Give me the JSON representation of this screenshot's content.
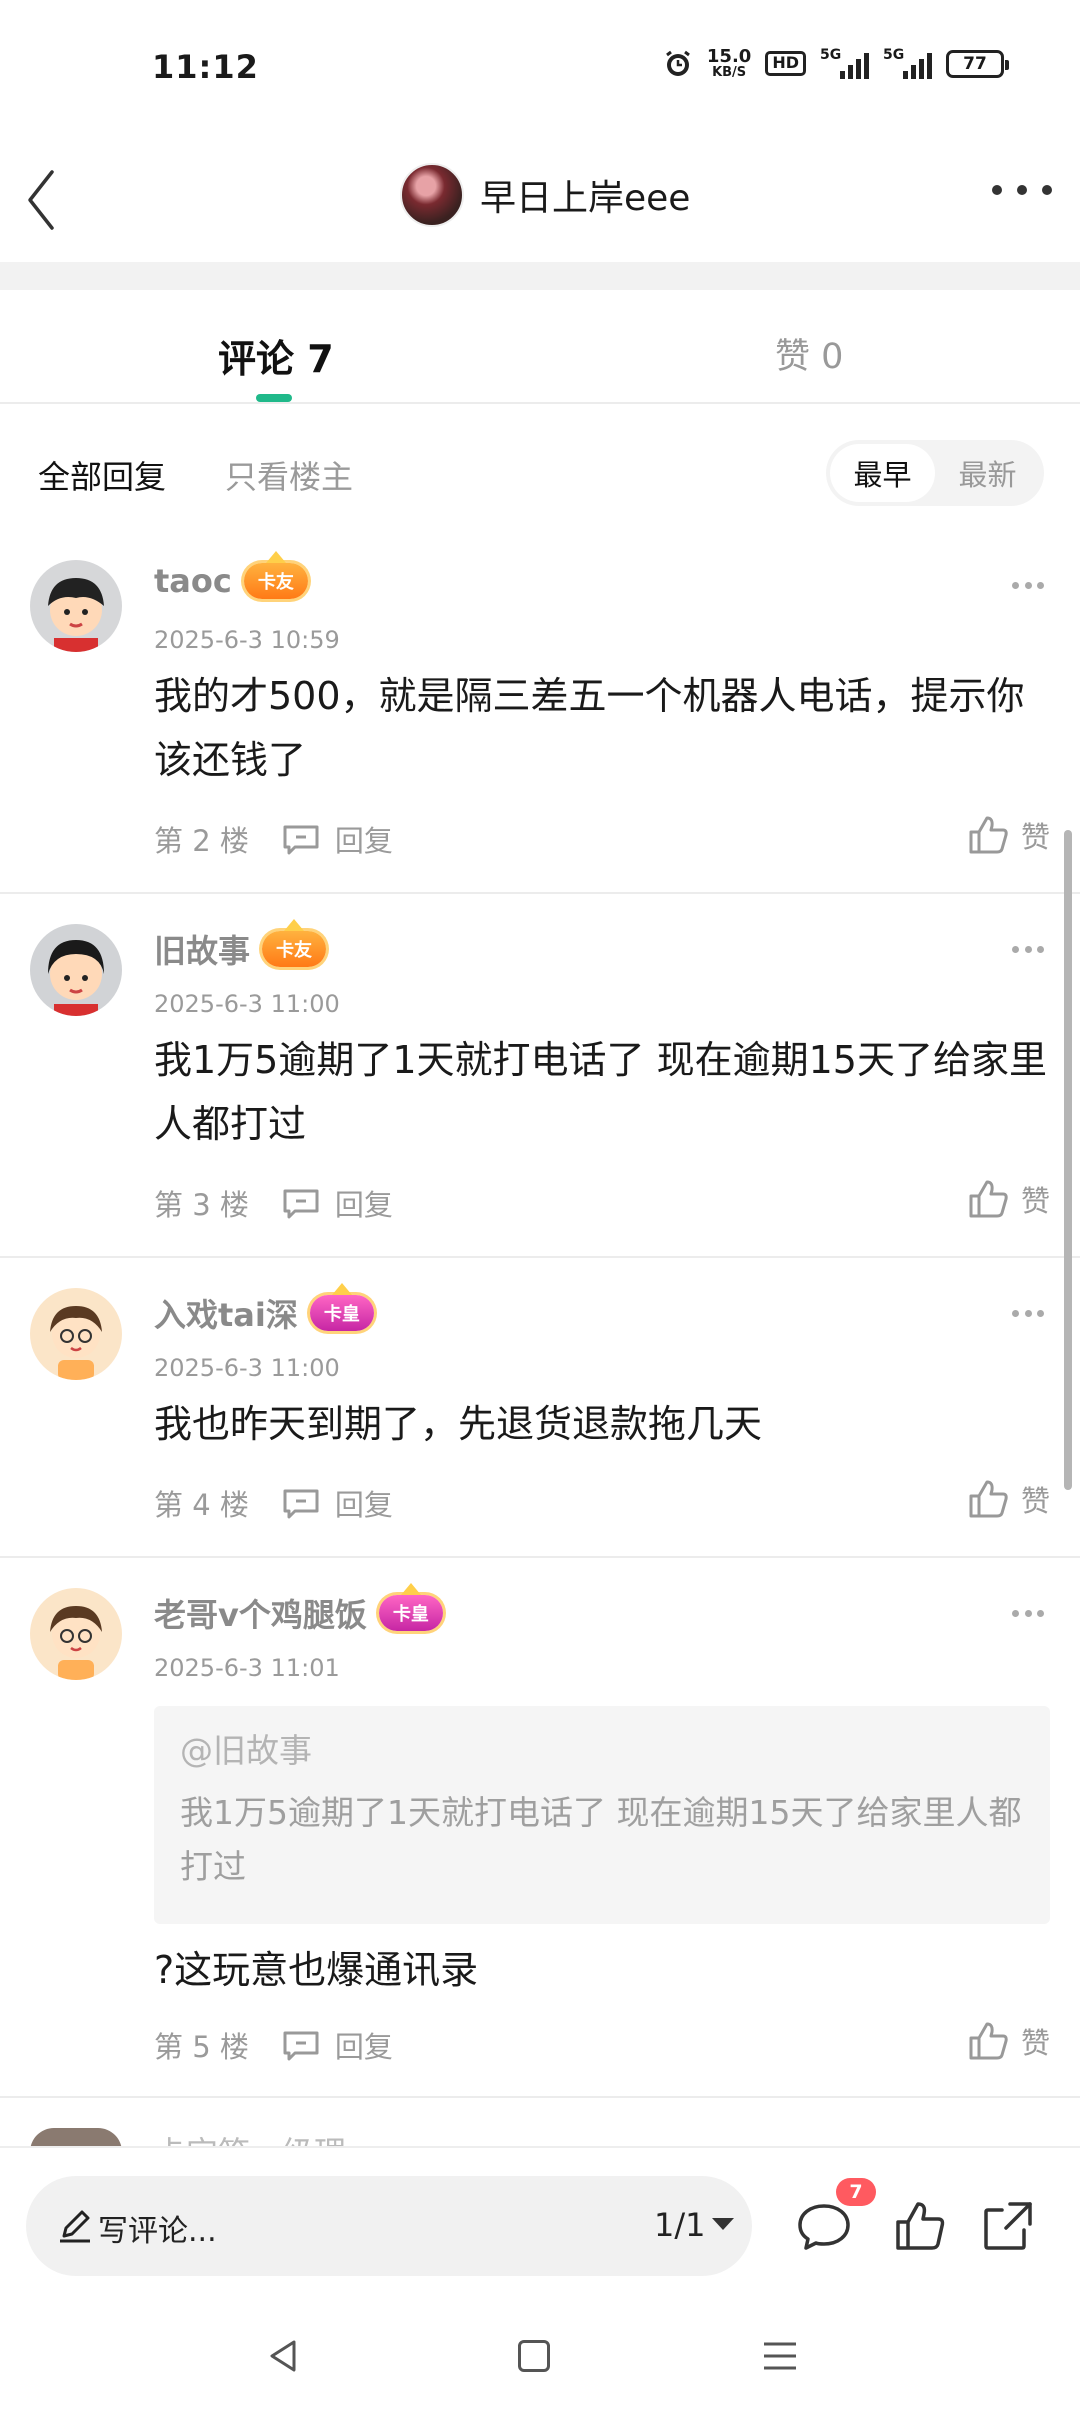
{
  "status_bar": {
    "time": "11:12",
    "net_speed_value": "15.0",
    "net_speed_unit": "KB/S",
    "hd_label": "HD",
    "signal1_label": "5G",
    "signal2_label": "5G",
    "battery": "77"
  },
  "header": {
    "title": "早日上岸eee"
  },
  "tabs": {
    "comments": "评论 7",
    "likes": "赞 0"
  },
  "filter": {
    "all_replies": "全部回复",
    "op_only": "只看楼主",
    "sort_earliest": "最早",
    "sort_latest": "最新"
  },
  "comments": [
    {
      "username": "taoc",
      "badge": "卡友",
      "time": "2025-6-3 10:59",
      "text": "我的才500，就是隔三差五一个机器人电话，提示你该还钱了",
      "floor": "第 2 楼",
      "reply": "回复",
      "like": "赞"
    },
    {
      "username": "旧故事",
      "badge": "卡友",
      "time": "2025-6-3 11:00",
      "text": "我1万5逾期了1天就打电话了 现在逾期15天了给家里人都打过",
      "floor": "第 3 楼",
      "reply": "回复",
      "like": "赞"
    },
    {
      "username": "入戏tai深",
      "badge": "卡皇",
      "time": "2025-6-3 11:00",
      "text": "我也昨天到期了，先退货退款拖几天",
      "floor": "第 4 楼",
      "reply": "回复",
      "like": "赞"
    },
    {
      "username": "老哥v个鸡腿饭",
      "badge": "卡皇",
      "time": "2025-6-3 11:01",
      "quote_user": "@旧故事",
      "quote_text": "我1万5逾期了1天就打电话了 现在逾期15天了给家里人都打过",
      "text": "?这玩意也爆通讯录",
      "floor": "第 5 楼",
      "reply": "回复",
      "like": "赞"
    }
  ],
  "peek_comment": {
    "username": "卡宝箱一级理"
  },
  "bottom_bar": {
    "input_placeholder": "写评论...",
    "page_indicator": "1/1",
    "comment_count": "7"
  },
  "colors": {
    "accent": "#20b98a",
    "badge_friend": "#ff8a1f",
    "badge_emperor": "#d930b0",
    "notification": "#ff5a60"
  }
}
